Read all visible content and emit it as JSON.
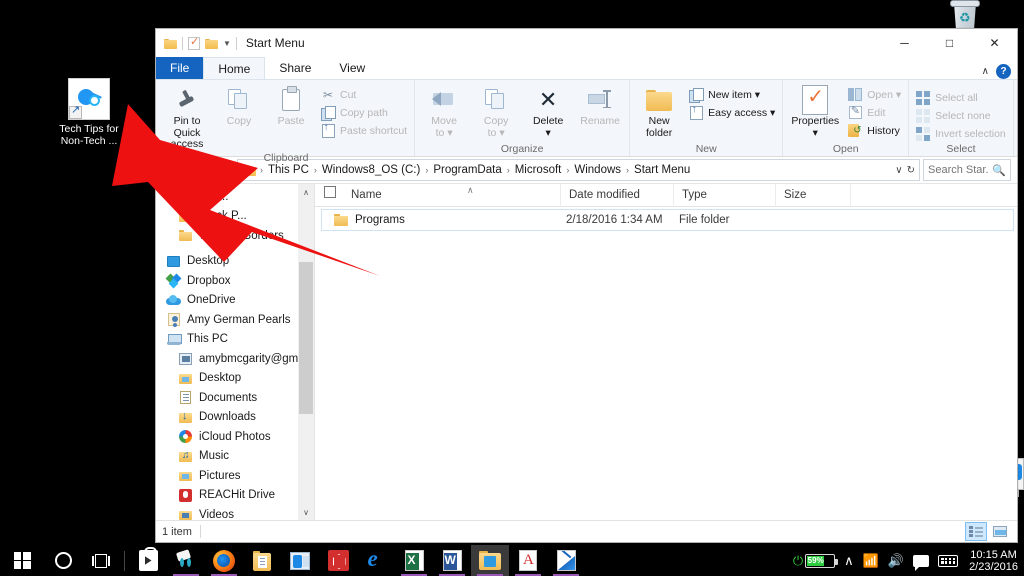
{
  "desktop": {
    "icons": [
      {
        "name": "tech-tips-shortcut",
        "label_line1": "Tech Tips for",
        "label_line2": "Non-Tech ...",
        "icon": "shortcut-icon"
      },
      {
        "name": "recycle-bin",
        "label_line1": "",
        "label_line2": "",
        "icon": "recycle-bin-icon"
      }
    ]
  },
  "window": {
    "title": "Start Menu",
    "quick_access": [
      "folder-icon",
      "properties-icon",
      "new-folder-icon",
      "customize-caret-icon"
    ],
    "buttons": {
      "minimize": "─",
      "maximize": "□",
      "close": "✕"
    },
    "ribbon_collapse": "∧",
    "help": "?"
  },
  "tabs": [
    {
      "label": "File",
      "state": "file"
    },
    {
      "label": "Home",
      "state": "active"
    },
    {
      "label": "Share",
      "state": "normal"
    },
    {
      "label": "View",
      "state": "normal"
    }
  ],
  "ribbon": {
    "groups": [
      {
        "name": "Clipboard",
        "big_buttons": [
          {
            "label_line1": "Pin to Quick",
            "label_line2": "access",
            "icon": "pin-icon",
            "disabled": false
          },
          {
            "label_line1": "Copy",
            "label_line2": "",
            "icon": "copy-icon",
            "disabled": true
          },
          {
            "label_line1": "Paste",
            "label_line2": "",
            "icon": "paste-icon",
            "disabled": true
          }
        ],
        "small_buttons": [
          {
            "label": "Cut",
            "icon": "scissors-icon",
            "disabled": true
          },
          {
            "label": "Copy path",
            "icon": "copy-path-icon",
            "disabled": true
          },
          {
            "label": "Paste shortcut",
            "icon": "paste-shortcut-icon",
            "disabled": true
          }
        ]
      },
      {
        "name": "Organize",
        "big_buttons": [
          {
            "label_line1": "Move",
            "label_line2": "to ▾",
            "icon": "move-to-icon",
            "disabled": true
          },
          {
            "label_line1": "Copy",
            "label_line2": "to ▾",
            "icon": "copy-to-icon",
            "disabled": true
          },
          {
            "label_line1": "Delete",
            "label_line2": "▾",
            "icon": "delete-icon",
            "disabled": false
          },
          {
            "label_line1": "Rename",
            "label_line2": "",
            "icon": "rename-icon",
            "disabled": true
          }
        ],
        "small_buttons": []
      },
      {
        "name": "New",
        "big_buttons": [
          {
            "label_line1": "New",
            "label_line2": "folder",
            "icon": "new-folder-icon",
            "disabled": false
          }
        ],
        "small_buttons": [
          {
            "label": "New item ▾",
            "icon": "new-item-icon",
            "disabled": false
          },
          {
            "label": "Easy access ▾",
            "icon": "easy-access-icon",
            "disabled": false
          }
        ]
      },
      {
        "name": "Open",
        "big_buttons": [
          {
            "label_line1": "Properties",
            "label_line2": "▾",
            "icon": "properties-icon",
            "disabled": false
          }
        ],
        "small_buttons": [
          {
            "label": "Open ▾",
            "icon": "open-icon",
            "disabled": true
          },
          {
            "label": "Edit",
            "icon": "edit-icon",
            "disabled": true
          },
          {
            "label": "History",
            "icon": "history-icon",
            "disabled": false
          }
        ]
      },
      {
        "name": "Select",
        "big_buttons": [],
        "small_buttons": [
          {
            "label": "Select all",
            "icon": "select-all-icon",
            "disabled": true
          },
          {
            "label": "Select none",
            "icon": "select-none-icon",
            "disabled": true
          },
          {
            "label": "Invert selection",
            "icon": "invert-selection-icon",
            "disabled": true
          }
        ]
      }
    ]
  },
  "address_bar": {
    "back": "←",
    "forward": "→",
    "up": "↑",
    "breadcrumbs": [
      "This PC",
      "Windows8_OS (C:)",
      "ProgramData",
      "Microsoft",
      "Windows",
      "Start Menu"
    ],
    "separator": "›",
    "dropdown": "∨",
    "refresh": "↻",
    "search_value": "",
    "search_placeholder": "Search Star..."
  },
  "nav_pane": {
    "items": [
      {
        "label": "Pos...",
        "icon": "folder-icon",
        "indent": true
      },
      {
        "label": "Stock P...",
        "icon": "folder-icon",
        "indent": true
      },
      {
        "label": "Webiste Borders",
        "icon": "folder-icon",
        "indent": true
      },
      {
        "label": "Desktop",
        "icon": "desktop-icon",
        "indent": false
      },
      {
        "label": "Dropbox",
        "icon": "dropbox-icon",
        "indent": false
      },
      {
        "label": "OneDrive",
        "icon": "onedrive-icon",
        "indent": false
      },
      {
        "label": "Amy German Pearls",
        "icon": "user-icon",
        "indent": false
      },
      {
        "label": "This PC",
        "icon": "this-pc-icon",
        "indent": false
      },
      {
        "label": "amybmcgarity@gmail.com",
        "icon": "mail-folder-icon",
        "indent": true
      },
      {
        "label": "Desktop",
        "icon": "desktop-folder-icon",
        "indent": true
      },
      {
        "label": "Documents",
        "icon": "documents-icon",
        "indent": true
      },
      {
        "label": "Downloads",
        "icon": "downloads-icon",
        "indent": true
      },
      {
        "label": "iCloud Photos",
        "icon": "icloud-photos-icon",
        "indent": true
      },
      {
        "label": "Music",
        "icon": "music-icon",
        "indent": true
      },
      {
        "label": "Pictures",
        "icon": "pictures-icon",
        "indent": true
      },
      {
        "label": "REACHit Drive",
        "icon": "reachit-icon",
        "indent": true
      },
      {
        "label": "Videos",
        "icon": "videos-icon",
        "indent": true
      }
    ],
    "scroll_up": "∧",
    "scroll_down": "∨"
  },
  "file_list": {
    "columns": [
      "Name",
      "Date modified",
      "Type",
      "Size"
    ],
    "sort_indicator": "∧",
    "rows": [
      {
        "name": "Programs",
        "date_modified": "2/18/2016 1:34 AM",
        "type": "File folder",
        "size": "",
        "icon": "folder-icon"
      }
    ]
  },
  "status_bar": {
    "item_count": "1 item",
    "view_details": "details-view-icon",
    "view_large": "large-icons-view-icon"
  },
  "taskbar": {
    "items": [
      {
        "name": "start-button",
        "icon": "windows-logo-icon"
      },
      {
        "name": "cortana-button",
        "icon": "cortana-circle-icon"
      },
      {
        "name": "task-view-button",
        "icon": "task-view-icon"
      },
      {
        "name": "store-button",
        "icon": "store-icon",
        "open": false
      },
      {
        "name": "snipping-tool-button",
        "icon": "snipping-tool-icon",
        "open": true
      },
      {
        "name": "firefox-button",
        "icon": "firefox-icon",
        "open": true
      },
      {
        "name": "notes-button",
        "icon": "notes-folder-icon",
        "open": false
      },
      {
        "name": "outlook-button",
        "icon": "outlook-icon",
        "open": false
      },
      {
        "name": "red-app-button",
        "icon": "red-cube-icon",
        "open": false
      },
      {
        "name": "edge-button",
        "icon": "edge-icon",
        "open": false
      },
      {
        "name": "excel-button",
        "icon": "excel-icon",
        "open": true
      },
      {
        "name": "word-button",
        "icon": "word-icon",
        "open": true
      },
      {
        "name": "file-explorer-button",
        "icon": "file-explorer-icon",
        "open": true
      },
      {
        "name": "acrobat-button",
        "icon": "acrobat-icon",
        "open": true
      },
      {
        "name": "blue-app-button",
        "icon": "blue-app-icon",
        "open": true
      }
    ],
    "tray": {
      "battery_percent": "59",
      "battery_unit": "%",
      "show_hidden": "∧",
      "wifi": "wifi-icon",
      "volume": "volume-icon",
      "action_center": "action-center-icon",
      "keyboard": "keyboard-icon",
      "time": "10:15 AM",
      "date": "2/23/2016"
    }
  },
  "annotation": {
    "arrow_color": "#ee1111",
    "arrow_name": "red-pointer-arrow"
  }
}
